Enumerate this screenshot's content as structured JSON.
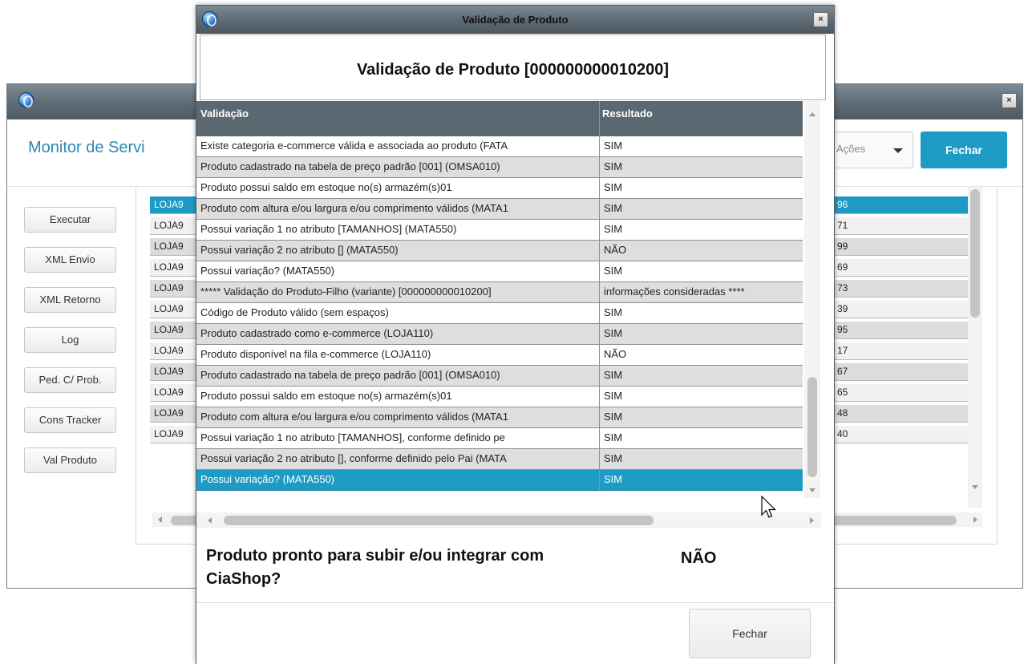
{
  "background_window": {
    "title": "Monitor de Servi",
    "acoes_label": "Ações",
    "fechar_label": "Fechar",
    "side_buttons": [
      "Executar",
      "XML Envio",
      "XML Retorno",
      "Log",
      "Ped. C/ Prob.",
      "Cons Tracker",
      "Val Produto"
    ],
    "rows": [
      {
        "c1": "LOJA9",
        "c2": "96"
      },
      {
        "c1": "LOJA9",
        "c2": "71"
      },
      {
        "c1": "LOJA9",
        "c2": "99"
      },
      {
        "c1": "LOJA9",
        "c2": "69"
      },
      {
        "c1": "LOJA9",
        "c2": "73"
      },
      {
        "c1": "LOJA9",
        "c2": "39"
      },
      {
        "c1": "LOJA9",
        "c2": "95"
      },
      {
        "c1": "LOJA9",
        "c2": "17"
      },
      {
        "c1": "LOJA9",
        "c2": "67"
      },
      {
        "c1": "LOJA9",
        "c2": "65"
      },
      {
        "c1": "LOJA9",
        "c2": "48"
      },
      {
        "c1": "LOJA9",
        "c2": "40"
      }
    ]
  },
  "modal": {
    "title": "Validação de Produto",
    "header": "Validação de Produto [000000000010200]",
    "columns": [
      "Validação",
      "Resultado"
    ],
    "rows": [
      {
        "validacao": "Existe categoria e-commerce válida e associada ao produto (FATA",
        "resultado": "SIM"
      },
      {
        "validacao": "Produto cadastrado na tabela de preço padrão [001] (OMSA010)",
        "resultado": "SIM"
      },
      {
        "validacao": "Produto possui saldo em estoque  no(s) armazém(s)01",
        "resultado": "SIM"
      },
      {
        "validacao": "Produto com altura e/ou largura e/ou comprimento válidos (MATA1",
        "resultado": "SIM"
      },
      {
        "validacao": "Possui variação 1 no atributo [TAMANHOS] (MATA550)",
        "resultado": "SIM"
      },
      {
        "validacao": "Possui variação 2 no atributo [] (MATA550)",
        "resultado": "NÃO"
      },
      {
        "validacao": "Possui variação? (MATA550)",
        "resultado": "SIM"
      },
      {
        "validacao": "*****  Validação do Produto-Filho (variante) [000000000010200]",
        "resultado": " informações consideradas ****"
      },
      {
        "validacao": "Código de Produto válido (sem espaços)",
        "resultado": "SIM"
      },
      {
        "validacao": "Produto cadastrado como e-commerce (LOJA110)",
        "resultado": "SIM"
      },
      {
        "validacao": "Produto disponível na fila e-commerce (LOJA110)",
        "resultado": "NÃO"
      },
      {
        "validacao": "Produto cadastrado na tabela de preço padrão [001] (OMSA010)",
        "resultado": "SIM"
      },
      {
        "validacao": "Produto possui saldo em estoque  no(s) armazém(s)01",
        "resultado": "SIM"
      },
      {
        "validacao": "Produto com altura e/ou largura e/ou comprimento válidos (MATA1",
        "resultado": "SIM"
      },
      {
        "validacao": "Possui variação 1 no atributo [TAMANHOS], conforme definido pe",
        "resultado": "SIM"
      },
      {
        "validacao": "Possui variação 2 no atributo [], conforme definido pelo Pai (MATA",
        "resultado": "SIM"
      },
      {
        "validacao": "Possui variação? (MATA550)",
        "resultado": "SIM"
      }
    ],
    "summary_label": "Produto pronto para subir e/ou integrar com CiaShop?",
    "summary_value": "NÃO",
    "fechar_label": "Fechar"
  },
  "colors": {
    "accent": "#1e9bc4",
    "grid_header": "#5a6872",
    "titlebar": "#5d6973"
  }
}
